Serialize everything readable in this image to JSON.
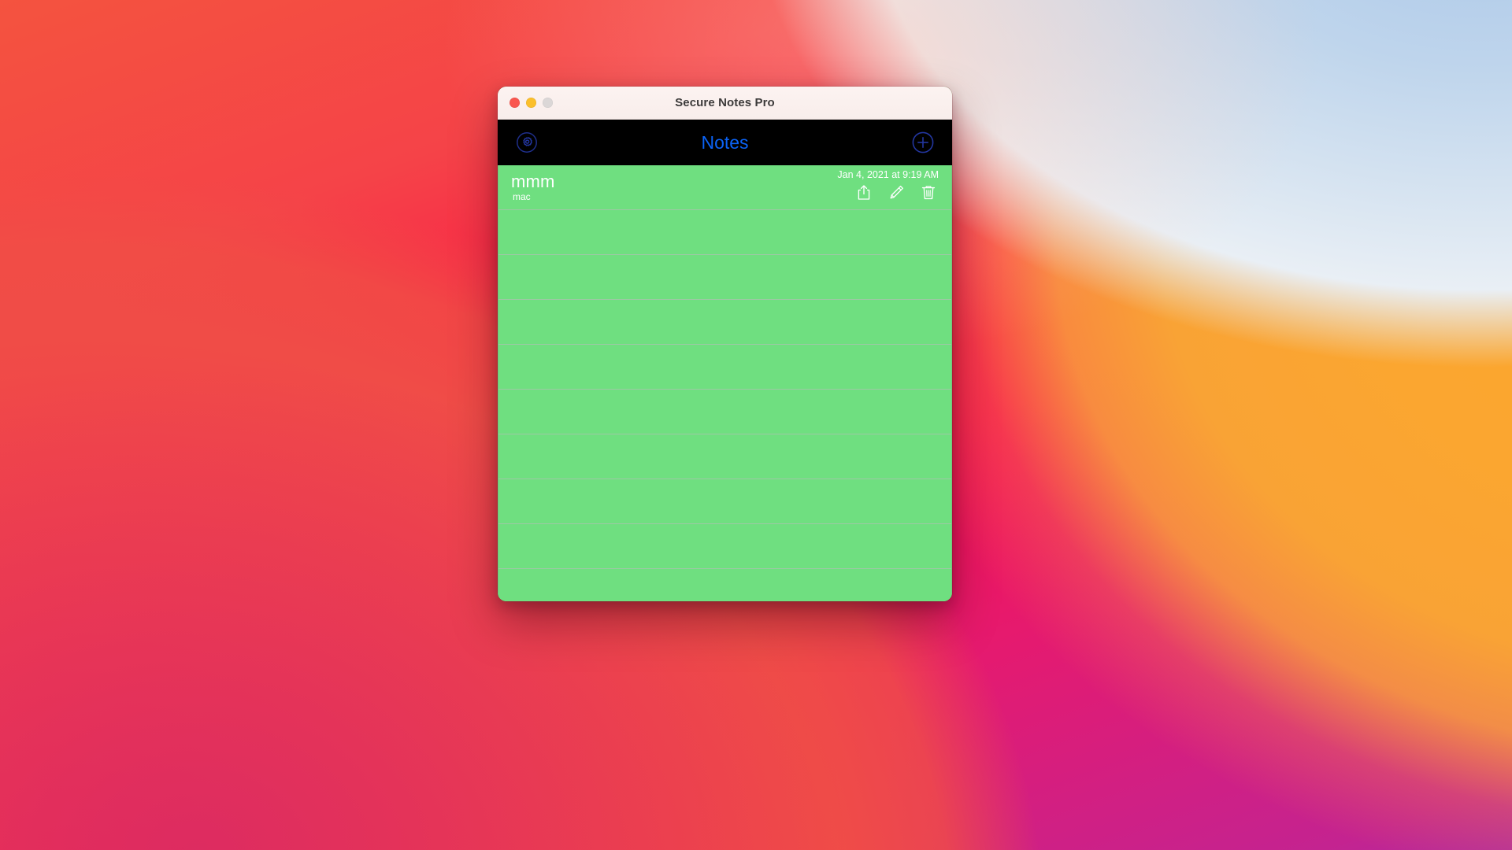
{
  "desktop": {
    "wallpaper_name": "big-sur-gradient",
    "colors": {
      "sky_blue": "#BFD5EC",
      "orange": "#FBA52B",
      "red": "#F3455A",
      "magenta": "#C4239 0"
    }
  },
  "window": {
    "title": "Secure Notes Pro",
    "traffic_lights": [
      {
        "name": "close",
        "color": "#F9564F"
      },
      {
        "name": "minimize",
        "color": "#FBBF2B"
      },
      {
        "name": "zoom",
        "color": "#DBD7D7"
      }
    ]
  },
  "navbar": {
    "title": "Notes",
    "title_color": "#0B63F6",
    "background": "#000000",
    "settings_icon": "gear-icon",
    "add_icon": "plus-circle-icon"
  },
  "notes_list": {
    "background": "#6FDF80",
    "divider_color": "#9DC8A5",
    "empty_row_count": 9,
    "notes": [
      {
        "title": "mmm",
        "subtitle": "mac",
        "date": "Jan 4, 2021 at 9:19 AM",
        "actions": [
          {
            "name": "share",
            "icon": "share-icon"
          },
          {
            "name": "edit",
            "icon": "pencil-icon"
          },
          {
            "name": "delete",
            "icon": "trash-icon"
          }
        ]
      }
    ]
  }
}
